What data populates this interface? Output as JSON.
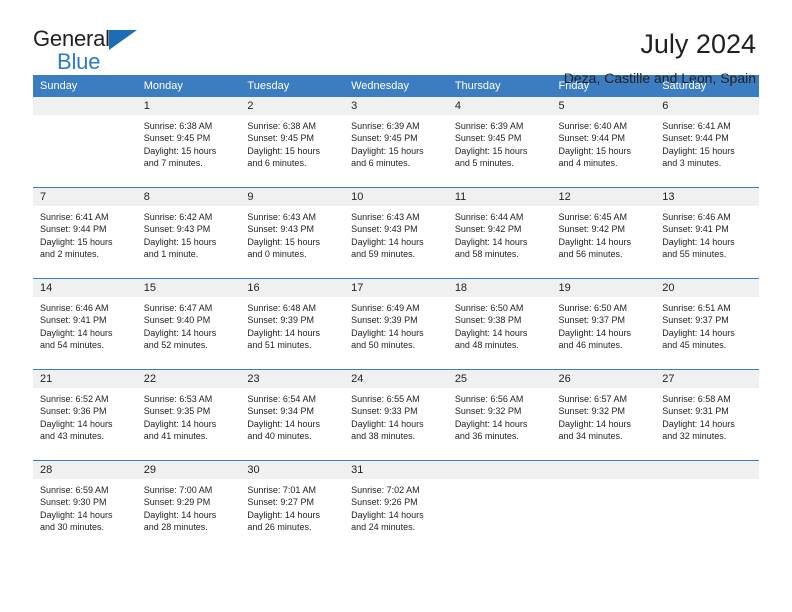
{
  "brand": {
    "name_top": "General",
    "name_bottom": "Blue",
    "triangle_color": "#1d6cb5",
    "blue_color": "#2b7cc4"
  },
  "header": {
    "title": "July 2024",
    "subtitle": "Deza, Castille and Leon, Spain"
  },
  "calendar": {
    "accent_color": "#3b7dc0",
    "daynum_bg": "#f0f0f0",
    "weekday_headers": [
      "Sunday",
      "Monday",
      "Tuesday",
      "Wednesday",
      "Thursday",
      "Friday",
      "Saturday"
    ],
    "weeks": [
      [
        {
          "day": "",
          "lines": []
        },
        {
          "day": "1",
          "lines": [
            "Sunrise: 6:38 AM",
            "Sunset: 9:45 PM",
            "Daylight: 15 hours",
            "and 7 minutes."
          ]
        },
        {
          "day": "2",
          "lines": [
            "Sunrise: 6:38 AM",
            "Sunset: 9:45 PM",
            "Daylight: 15 hours",
            "and 6 minutes."
          ]
        },
        {
          "day": "3",
          "lines": [
            "Sunrise: 6:39 AM",
            "Sunset: 9:45 PM",
            "Daylight: 15 hours",
            "and 6 minutes."
          ]
        },
        {
          "day": "4",
          "lines": [
            "Sunrise: 6:39 AM",
            "Sunset: 9:45 PM",
            "Daylight: 15 hours",
            "and 5 minutes."
          ]
        },
        {
          "day": "5",
          "lines": [
            "Sunrise: 6:40 AM",
            "Sunset: 9:44 PM",
            "Daylight: 15 hours",
            "and 4 minutes."
          ]
        },
        {
          "day": "6",
          "lines": [
            "Sunrise: 6:41 AM",
            "Sunset: 9:44 PM",
            "Daylight: 15 hours",
            "and 3 minutes."
          ]
        }
      ],
      [
        {
          "day": "7",
          "lines": [
            "Sunrise: 6:41 AM",
            "Sunset: 9:44 PM",
            "Daylight: 15 hours",
            "and 2 minutes."
          ]
        },
        {
          "day": "8",
          "lines": [
            "Sunrise: 6:42 AM",
            "Sunset: 9:43 PM",
            "Daylight: 15 hours",
            "and 1 minute."
          ]
        },
        {
          "day": "9",
          "lines": [
            "Sunrise: 6:43 AM",
            "Sunset: 9:43 PM",
            "Daylight: 15 hours",
            "and 0 minutes."
          ]
        },
        {
          "day": "10",
          "lines": [
            "Sunrise: 6:43 AM",
            "Sunset: 9:43 PM",
            "Daylight: 14 hours",
            "and 59 minutes."
          ]
        },
        {
          "day": "11",
          "lines": [
            "Sunrise: 6:44 AM",
            "Sunset: 9:42 PM",
            "Daylight: 14 hours",
            "and 58 minutes."
          ]
        },
        {
          "day": "12",
          "lines": [
            "Sunrise: 6:45 AM",
            "Sunset: 9:42 PM",
            "Daylight: 14 hours",
            "and 56 minutes."
          ]
        },
        {
          "day": "13",
          "lines": [
            "Sunrise: 6:46 AM",
            "Sunset: 9:41 PM",
            "Daylight: 14 hours",
            "and 55 minutes."
          ]
        }
      ],
      [
        {
          "day": "14",
          "lines": [
            "Sunrise: 6:46 AM",
            "Sunset: 9:41 PM",
            "Daylight: 14 hours",
            "and 54 minutes."
          ]
        },
        {
          "day": "15",
          "lines": [
            "Sunrise: 6:47 AM",
            "Sunset: 9:40 PM",
            "Daylight: 14 hours",
            "and 52 minutes."
          ]
        },
        {
          "day": "16",
          "lines": [
            "Sunrise: 6:48 AM",
            "Sunset: 9:39 PM",
            "Daylight: 14 hours",
            "and 51 minutes."
          ]
        },
        {
          "day": "17",
          "lines": [
            "Sunrise: 6:49 AM",
            "Sunset: 9:39 PM",
            "Daylight: 14 hours",
            "and 50 minutes."
          ]
        },
        {
          "day": "18",
          "lines": [
            "Sunrise: 6:50 AM",
            "Sunset: 9:38 PM",
            "Daylight: 14 hours",
            "and 48 minutes."
          ]
        },
        {
          "day": "19",
          "lines": [
            "Sunrise: 6:50 AM",
            "Sunset: 9:37 PM",
            "Daylight: 14 hours",
            "and 46 minutes."
          ]
        },
        {
          "day": "20",
          "lines": [
            "Sunrise: 6:51 AM",
            "Sunset: 9:37 PM",
            "Daylight: 14 hours",
            "and 45 minutes."
          ]
        }
      ],
      [
        {
          "day": "21",
          "lines": [
            "Sunrise: 6:52 AM",
            "Sunset: 9:36 PM",
            "Daylight: 14 hours",
            "and 43 minutes."
          ]
        },
        {
          "day": "22",
          "lines": [
            "Sunrise: 6:53 AM",
            "Sunset: 9:35 PM",
            "Daylight: 14 hours",
            "and 41 minutes."
          ]
        },
        {
          "day": "23",
          "lines": [
            "Sunrise: 6:54 AM",
            "Sunset: 9:34 PM",
            "Daylight: 14 hours",
            "and 40 minutes."
          ]
        },
        {
          "day": "24",
          "lines": [
            "Sunrise: 6:55 AM",
            "Sunset: 9:33 PM",
            "Daylight: 14 hours",
            "and 38 minutes."
          ]
        },
        {
          "day": "25",
          "lines": [
            "Sunrise: 6:56 AM",
            "Sunset: 9:32 PM",
            "Daylight: 14 hours",
            "and 36 minutes."
          ]
        },
        {
          "day": "26",
          "lines": [
            "Sunrise: 6:57 AM",
            "Sunset: 9:32 PM",
            "Daylight: 14 hours",
            "and 34 minutes."
          ]
        },
        {
          "day": "27",
          "lines": [
            "Sunrise: 6:58 AM",
            "Sunset: 9:31 PM",
            "Daylight: 14 hours",
            "and 32 minutes."
          ]
        }
      ],
      [
        {
          "day": "28",
          "lines": [
            "Sunrise: 6:59 AM",
            "Sunset: 9:30 PM",
            "Daylight: 14 hours",
            "and 30 minutes."
          ]
        },
        {
          "day": "29",
          "lines": [
            "Sunrise: 7:00 AM",
            "Sunset: 9:29 PM",
            "Daylight: 14 hours",
            "and 28 minutes."
          ]
        },
        {
          "day": "30",
          "lines": [
            "Sunrise: 7:01 AM",
            "Sunset: 9:27 PM",
            "Daylight: 14 hours",
            "and 26 minutes."
          ]
        },
        {
          "day": "31",
          "lines": [
            "Sunrise: 7:02 AM",
            "Sunset: 9:26 PM",
            "Daylight: 14 hours",
            "and 24 minutes."
          ]
        },
        {
          "day": "",
          "lines": []
        },
        {
          "day": "",
          "lines": []
        },
        {
          "day": "",
          "lines": []
        }
      ]
    ]
  }
}
